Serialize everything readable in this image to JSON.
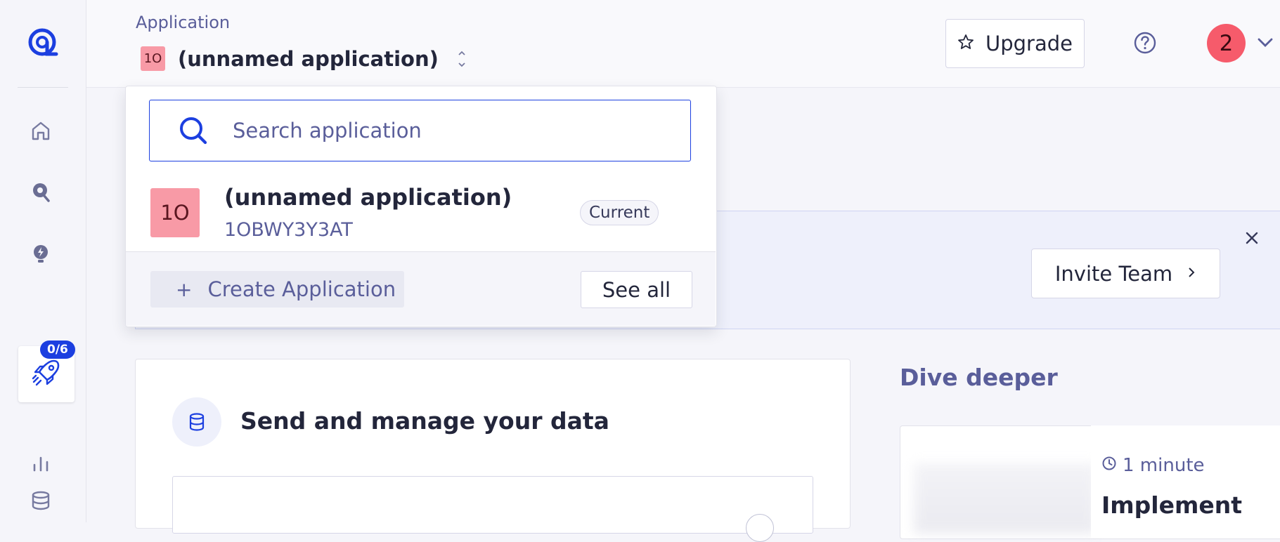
{
  "header": {
    "app_label": "Application",
    "current_app": {
      "initials": "1O",
      "name": "(unnamed application)"
    },
    "upgrade_label": "Upgrade",
    "notifications_count": "2"
  },
  "sidebar": {
    "onboarding_progress": "0/6"
  },
  "dropdown": {
    "search_placeholder": "Search application",
    "apps": [
      {
        "initials": "1O",
        "name": "(unnamed application)",
        "id": "1OBWY3Y3AT",
        "tag": "Current"
      }
    ],
    "create_label": "Create Application",
    "see_all_label": "See all"
  },
  "banner": {
    "invite_label": "Invite Team"
  },
  "main": {
    "card_title": "Send and manage your data",
    "dive_title": "Dive deeper",
    "dive_card": {
      "duration": "1 minute",
      "heading": "Implement"
    }
  },
  "colors": {
    "accent": "#1c3fe0",
    "app_badge": "#f89aa6",
    "avatar": "#f65b6b",
    "muted_text": "#5a5e9a"
  }
}
